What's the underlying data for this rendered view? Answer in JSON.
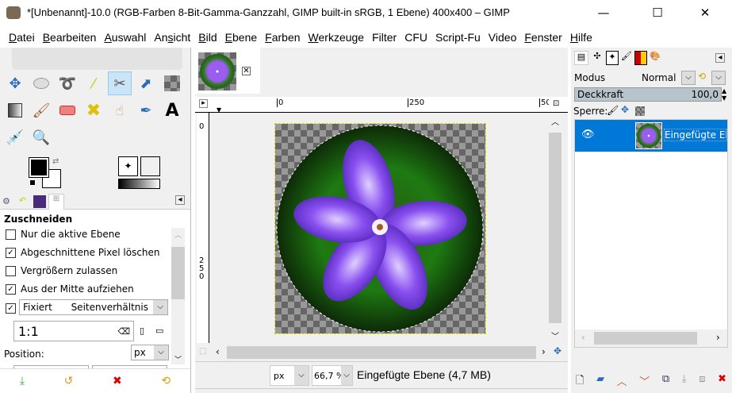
{
  "window": {
    "title": "*[Unbenannt]-10.0 (RGB-Farben 8-Bit-Gamma-Ganzzahl, GIMP built-in sRGB, 1 Ebene) 400x400 – GIMP",
    "minimize": "—",
    "maximize": "☐",
    "close": "✕"
  },
  "menu": [
    {
      "u": "D",
      "rest": "atei"
    },
    {
      "u": "B",
      "rest": "earbeiten"
    },
    {
      "u": "A",
      "rest": "uswahl"
    },
    {
      "u": "A",
      "rest": "nsicht",
      "pre": "",
      "label": "Ansicht"
    },
    {
      "u": "B",
      "rest": "ild"
    },
    {
      "u": "E",
      "rest": "bene"
    },
    {
      "u": "F",
      "rest": "arben"
    },
    {
      "u": "W",
      "rest": "erkzeuge"
    },
    {
      "u": "",
      "rest": "Filter"
    },
    {
      "u": "",
      "rest": "CFU"
    },
    {
      "u": "",
      "rest": "Script-Fu"
    },
    {
      "u": "",
      "rest": "Video"
    },
    {
      "u": "F",
      "rest": "enster"
    },
    {
      "u": "H",
      "rest": "ilfe"
    }
  ],
  "tool_options": {
    "title": "Zuschneiden",
    "checks": [
      {
        "label": "Nur die aktive Ebene",
        "checked": false
      },
      {
        "label": "Abgeschnittene Pixel löschen",
        "checked": true
      },
      {
        "label": "Vergrößern zulassen",
        "checked": false
      },
      {
        "label": "Aus der Mitte aufziehen",
        "checked": true
      }
    ],
    "fixed_label": "Fixiert",
    "fixed_mode": "Seitenverhältnis",
    "fixed_checked": true,
    "ratio": "1:1",
    "position_label": "Position:",
    "position_unit": "px"
  },
  "canvas": {
    "ruler_ticks": [
      "0",
      "250",
      "50"
    ],
    "vruler_ticks": [
      "0",
      "2",
      "5",
      "0"
    ],
    "unit": "px",
    "zoom": "66,7 %",
    "status": "Eingefügte Ebene (4,7 MB)"
  },
  "layers": {
    "mode_label": "Modus",
    "mode": "Normal",
    "opacity_label": "Deckkraft",
    "opacity": "100,0",
    "lock_label": "Sperre:",
    "items": [
      {
        "name": "Eingefügte Ebene",
        "visible": true,
        "selected": true
      }
    ]
  },
  "colors": {
    "selection": "#0078d7",
    "accent": "#cce4f7"
  }
}
